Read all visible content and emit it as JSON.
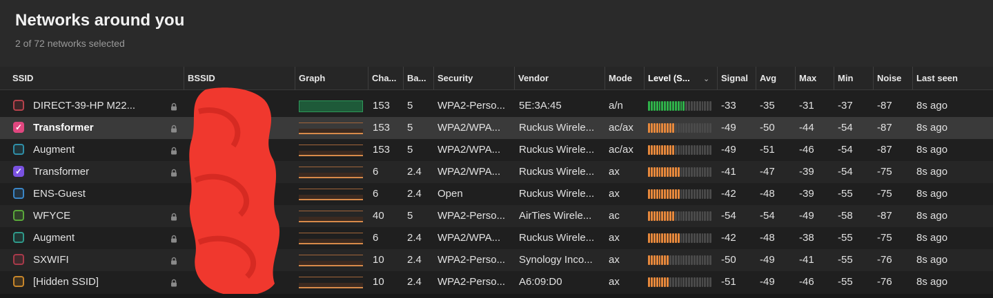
{
  "header": {
    "title": "Networks around you",
    "subtitle": "2 of 72 networks selected"
  },
  "columns": {
    "ssid": "SSID",
    "bssid": "BSSID",
    "graph": "Graph",
    "channel": "Cha...",
    "band": "Ba...",
    "security": "Security",
    "vendor": "Vendor",
    "mode": "Mode",
    "level": "Level (S...",
    "signal": "Signal",
    "avg": "Avg",
    "max": "Max",
    "min": "Min",
    "noise": "Noise",
    "last_seen": "Last seen"
  },
  "colors": {
    "green_level": "#2fb24a",
    "orange_level": "#e8893c",
    "empty_level": "#4a4a4a"
  },
  "rows": [
    {
      "ssid": "DIRECT-39-HP M22...",
      "checked": false,
      "color": "#b5424c",
      "locked": true,
      "channel": "153",
      "band": "5",
      "security": "WPA2-Perso...",
      "vendor": "5E:3A:45",
      "mode": "a/n",
      "level_bars": 14,
      "level_color": "green",
      "signal": "-33",
      "avg": "-35",
      "max": "-31",
      "min": "-37",
      "noise": "-87",
      "last_seen": "8s ago",
      "graph": "green"
    },
    {
      "ssid": "Transformer",
      "checked": true,
      "color": "#e0477f",
      "locked": true,
      "channel": "153",
      "band": "5",
      "security": "WPA2/WPA...",
      "vendor": "Ruckus Wirele...",
      "mode": "ac/ax",
      "level_bars": 10,
      "level_color": "orange",
      "signal": "-49",
      "avg": "-50",
      "max": "-44",
      "min": "-54",
      "noise": "-87",
      "last_seen": "8s ago",
      "graph": "orange"
    },
    {
      "ssid": "Augment",
      "checked": false,
      "color": "#2f8fa8",
      "locked": true,
      "channel": "153",
      "band": "5",
      "security": "WPA2/WPA...",
      "vendor": "Ruckus Wirele...",
      "mode": "ac/ax",
      "level_bars": 10,
      "level_color": "orange",
      "signal": "-49",
      "avg": "-51",
      "max": "-46",
      "min": "-54",
      "noise": "-87",
      "last_seen": "8s ago",
      "graph": "orange"
    },
    {
      "ssid": "Transformer",
      "checked": true,
      "color": "#7a52e0",
      "locked": true,
      "channel": "6",
      "band": "2.4",
      "security": "WPA2/WPA...",
      "vendor": "Ruckus Wirele...",
      "mode": "ax",
      "level_bars": 12,
      "level_color": "orange",
      "signal": "-41",
      "avg": "-47",
      "max": "-39",
      "min": "-54",
      "noise": "-75",
      "last_seen": "8s ago",
      "graph": "orange"
    },
    {
      "ssid": "ENS-Guest",
      "checked": false,
      "color": "#3a86c8",
      "locked": false,
      "channel": "6",
      "band": "2.4",
      "security": "Open",
      "vendor": "Ruckus Wirele...",
      "mode": "ax",
      "level_bars": 12,
      "level_color": "orange",
      "signal": "-42",
      "avg": "-48",
      "max": "-39",
      "min": "-55",
      "noise": "-75",
      "last_seen": "8s ago",
      "graph": "orange"
    },
    {
      "ssid": "WFYCE",
      "checked": false,
      "color": "#5aa83a",
      "locked": true,
      "channel": "40",
      "band": "5",
      "security": "WPA2-Perso...",
      "vendor": "AirTies Wirele...",
      "mode": "ac",
      "level_bars": 10,
      "level_color": "orange",
      "signal": "-54",
      "avg": "-54",
      "max": "-49",
      "min": "-58",
      "noise": "-87",
      "last_seen": "8s ago",
      "graph": "orange"
    },
    {
      "ssid": "Augment",
      "checked": false,
      "color": "#2f9a8a",
      "locked": true,
      "channel": "6",
      "band": "2.4",
      "security": "WPA2/WPA...",
      "vendor": "Ruckus Wirele...",
      "mode": "ax",
      "level_bars": 12,
      "level_color": "orange",
      "signal": "-42",
      "avg": "-48",
      "max": "-38",
      "min": "-55",
      "noise": "-75",
      "last_seen": "8s ago",
      "graph": "orange"
    },
    {
      "ssid": "SXWIFI",
      "checked": false,
      "color": "#a83a4a",
      "locked": true,
      "channel": "10",
      "band": "2.4",
      "security": "WPA2-Perso...",
      "vendor": "Synology Inco...",
      "mode": "ax",
      "level_bars": 8,
      "level_color": "orange",
      "signal": "-50",
      "avg": "-49",
      "max": "-41",
      "min": "-55",
      "noise": "-76",
      "last_seen": "8s ago",
      "graph": "orange"
    },
    {
      "ssid": "[Hidden SSID]",
      "checked": false,
      "color": "#c8862a",
      "locked": true,
      "channel": "10",
      "band": "2.4",
      "security": "WPA2-Perso...",
      "vendor": "A6:09:D0",
      "mode": "ax",
      "level_bars": 8,
      "level_color": "orange",
      "signal": "-51",
      "avg": "-49",
      "max": "-46",
      "min": "-55",
      "noise": "-76",
      "last_seen": "8s ago",
      "graph": "orange"
    }
  ]
}
